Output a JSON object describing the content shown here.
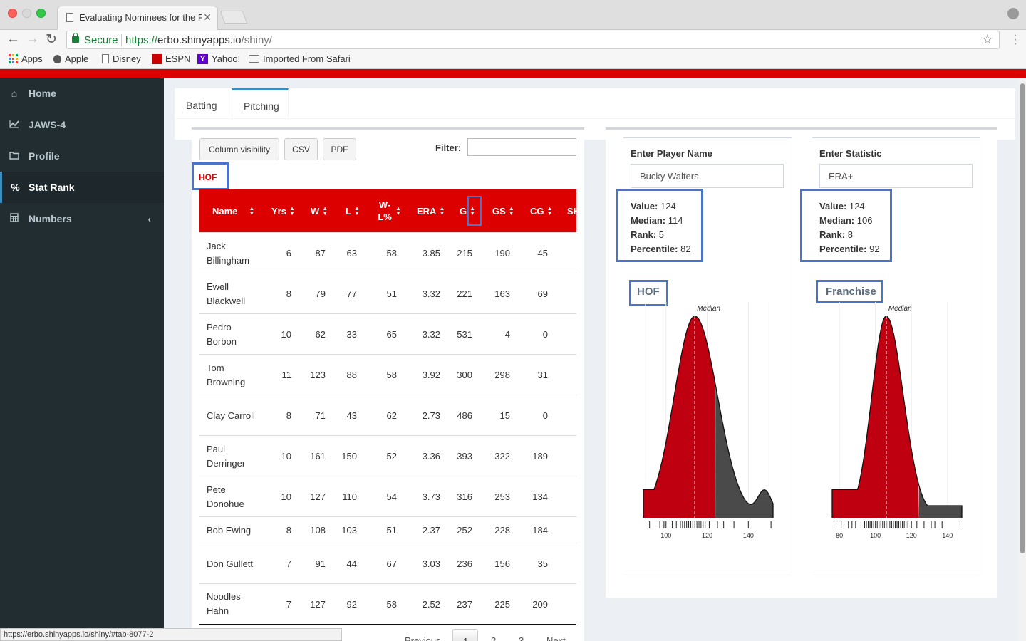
{
  "browser": {
    "tab_title": "Evaluating Nominees for the R",
    "secure_label": "Secure",
    "url_protocol": "https://",
    "url_host": "erbo.shinyapps.io",
    "url_path": "/shiny/",
    "bookmarks": [
      "Apps",
      "Apple",
      "Disney",
      "ESPN",
      "Yahoo!",
      "Imported From Safari"
    ],
    "status_url": "https://erbo.shinyapps.io/shiny/#tab-8077-2"
  },
  "sidebar": {
    "items": [
      {
        "label": "Home",
        "icon": "home-icon"
      },
      {
        "label": "JAWS-4",
        "icon": "line-chart-icon"
      },
      {
        "label": "Profile",
        "icon": "folder-icon"
      },
      {
        "label": "Stat Rank",
        "icon": "percent-icon"
      },
      {
        "label": "Numbers",
        "icon": "calculator-icon"
      }
    ]
  },
  "tabs": [
    {
      "label": "Batting",
      "active": false
    },
    {
      "label": "Pitching",
      "active": true
    }
  ],
  "table_controls": {
    "buttons": [
      "Column visibility",
      "CSV",
      "PDF"
    ],
    "filter_label": "Filter:",
    "filter_value": "",
    "section_label": "HOF"
  },
  "table": {
    "headers": [
      "Name",
      "Yrs",
      "W",
      "L",
      "W-L%",
      "ERA",
      "G",
      "GS",
      "CG",
      "SH"
    ],
    "rows": [
      {
        "name": "Jack Billingham",
        "yrs": "6",
        "w": "87",
        "l": "63",
        "wl": "58",
        "era": "3.85",
        "g": "215",
        "gs": "190",
        "cg": "45"
      },
      {
        "name": "Ewell Blackwell",
        "yrs": "8",
        "w": "79",
        "l": "77",
        "wl": "51",
        "era": "3.32",
        "g": "221",
        "gs": "163",
        "cg": "69"
      },
      {
        "name": "Pedro Borbon",
        "yrs": "10",
        "w": "62",
        "l": "33",
        "wl": "65",
        "era": "3.32",
        "g": "531",
        "gs": "4",
        "cg": "0"
      },
      {
        "name": "Tom Browning",
        "yrs": "11",
        "w": "123",
        "l": "88",
        "wl": "58",
        "era": "3.92",
        "g": "300",
        "gs": "298",
        "cg": "31"
      },
      {
        "name": "Clay Carroll",
        "yrs": "8",
        "w": "71",
        "l": "43",
        "wl": "62",
        "era": "2.73",
        "g": "486",
        "gs": "15",
        "cg": "0"
      },
      {
        "name": "Paul Derringer",
        "yrs": "10",
        "w": "161",
        "l": "150",
        "wl": "52",
        "era": "3.36",
        "g": "393",
        "gs": "322",
        "cg": "189"
      },
      {
        "name": "Pete Donohue",
        "yrs": "10",
        "w": "127",
        "l": "110",
        "wl": "54",
        "era": "3.73",
        "g": "316",
        "gs": "253",
        "cg": "134"
      },
      {
        "name": "Bob Ewing",
        "yrs": "8",
        "w": "108",
        "l": "103",
        "wl": "51",
        "era": "2.37",
        "g": "252",
        "gs": "228",
        "cg": "184"
      },
      {
        "name": "Don Gullett",
        "yrs": "7",
        "w": "91",
        "l": "44",
        "wl": "67",
        "era": "3.03",
        "g": "236",
        "gs": "156",
        "cg": "35"
      },
      {
        "name": "Noodles Hahn",
        "yrs": "7",
        "w": "127",
        "l": "92",
        "wl": "58",
        "era": "2.52",
        "g": "237",
        "gs": "225",
        "cg": "209"
      }
    ]
  },
  "pagination": {
    "previous": "Previous",
    "pages": [
      "1",
      "2",
      "3"
    ],
    "next": "Next"
  },
  "player_panel": {
    "title": "Enter Player Name",
    "value": "Bucky Walters",
    "stats": {
      "value_label": "Value:",
      "value": "124",
      "median_label": "Median:",
      "median": "114",
      "rank_label": "Rank:",
      "rank": "5",
      "percentile_label": "Percentile:",
      "percentile": "82"
    },
    "plot_title": "HOF"
  },
  "stat_panel": {
    "title": "Enter Statistic",
    "value": "ERA+",
    "stats": {
      "value_label": "Value:",
      "value": "124",
      "median_label": "Median:",
      "median": "106",
      "rank_label": "Rank:",
      "rank": "8",
      "percentile_label": "Percentile:",
      "percentile": "92"
    },
    "plot_title": "Franchise"
  },
  "chart_data": [
    {
      "type": "area",
      "title": "HOF",
      "annotation": "Median",
      "median": 114,
      "player_value": 124,
      "ticks": [
        100,
        120,
        140
      ],
      "xlim": [
        89,
        152
      ],
      "fill_colors": {
        "below_value": "#bf0010",
        "above_value": "#4a4a4a"
      }
    },
    {
      "type": "area",
      "title": "Franchise",
      "annotation": "Median",
      "median": 106,
      "player_value": 124,
      "ticks": [
        80,
        100,
        120,
        140
      ],
      "xlim": [
        76,
        148
      ],
      "fill_colors": {
        "below_value": "#bf0010",
        "above_value": "#4a4a4a"
      }
    }
  ]
}
